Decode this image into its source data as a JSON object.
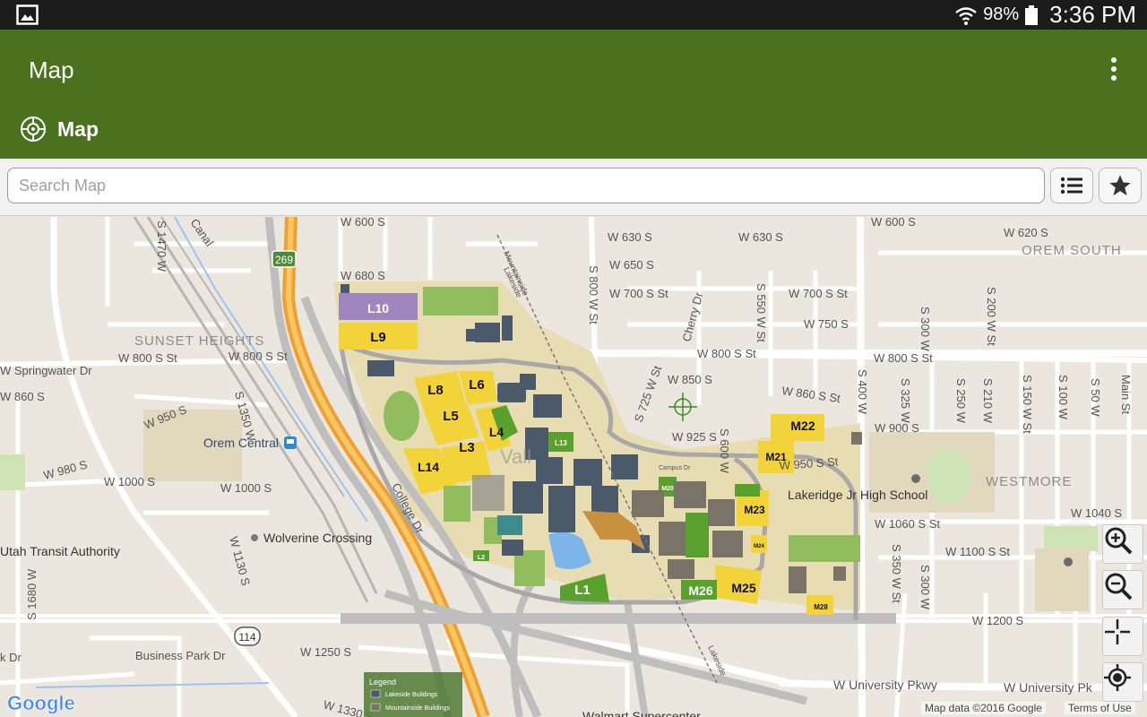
{
  "status_bar": {
    "battery": "98%",
    "time": "3:36 PM",
    "icons": [
      "gallery-icon",
      "wifi-icon",
      "battery-icon"
    ]
  },
  "app_bar": {
    "title": "Map",
    "section_label": "Map",
    "icons": [
      "overflow-menu-icon",
      "compass-icon"
    ]
  },
  "search": {
    "placeholder": "Search Map",
    "value": "",
    "list_icon": "list-icon",
    "favorites_icon": "star-icon"
  },
  "map": {
    "streets": {
      "w600s": "W 600 S",
      "w630s_a": "W 630 S",
      "w630s_b": "W 630 S",
      "w600s_r": "W 600 S",
      "w620s": "W 620 S",
      "w650s": "W 650 S",
      "w680s": "W 680 S",
      "w700st_a": "W 700 S St",
      "w700st_b": "W 700 S St",
      "w750s": "W 750 S",
      "w800st_a": "W 800 S St",
      "w800st_b": "W 800 S St",
      "w800st_c": "W 800 S St",
      "w800st_d": "W 800 S St",
      "springwater": "W Springwater Dr",
      "w860s_l": "W 860 S",
      "w850s": "W 850 S",
      "w860st": "W 860 S St",
      "w950s": "W 950 S",
      "w900s": "W 900 S",
      "w925s": "W 925 S",
      "w950st": "W 950 S St",
      "w980s": "W 980 S",
      "w1000s_a": "W 1000 S",
      "w1000s_b": "W 1000 S",
      "w1040s": "W 1040 S",
      "w1060st": "W 1060 S St",
      "w1100st": "W 1100 S St",
      "w1200s": "W 1200 S",
      "w1250s": "W 1250 S",
      "w1330s": "W 1330 S",
      "univ_a": "W University Pkwy",
      "univ_b": "W University Pk",
      "businesspark": "Business Park Dr",
      "kdr": "k Dr",
      "college_dr": "College Dr",
      "s1470w": "S 1470 W",
      "s1350w": "S 1350 W",
      "s1130s": "W 1130 S",
      "s1680w": "S 1680 W",
      "s800w": "S 800 W St",
      "s725w": "S 725 W St",
      "s600w": "S 600 W",
      "s550w": "S 550 W St",
      "s400w": "S 400 W",
      "s300w_a": "S 300 W",
      "s325w": "S 325 W",
      "s250w": "S 250 W",
      "s210w": "S 210 W",
      "s200w": "S 200 W St",
      "s150w": "S 150 W St",
      "s100w": "S 100 W",
      "s50w": "S 50 W",
      "mainst": "Main St",
      "s350w": "S 350 W St",
      "s300w_b": "S 300 W",
      "cherry": "Cherry Dr",
      "canal": "Canal",
      "mountainside": "Mountainside",
      "lakeside": "Lakeside",
      "lakeside2": "Lakeside",
      "campus_dr": "Campus Dr"
    },
    "places": {
      "orem_south": "OREM SOUTH",
      "sunset_heights": "SUNSET HEIGHTS",
      "westmore": "WESTMORE",
      "orem_central": "Orem Central",
      "lakeridge": "Lakeridge Jr High School",
      "wolverine": "Wolverine Crossing",
      "uta": "Utah Transit Authority",
      "walmart": "Walmart Supercenter",
      "campus_word": "Vall"
    },
    "routes": {
      "r269": "269",
      "r114": "114"
    },
    "lots": {
      "L10": "L10",
      "L9": "L9",
      "L8": "L8",
      "L6": "L6",
      "L5": "L5",
      "L4": "L4",
      "L3": "L3",
      "L14": "L14",
      "L13": "L13",
      "L1": "L1",
      "L2": "L2",
      "M22": "M22",
      "M21": "M21",
      "M23": "M23",
      "M20": "M20",
      "M24": "M24",
      "M25": "M25",
      "M26": "M26",
      "M28": "M28"
    },
    "legend": {
      "title": "Legend",
      "items": [
        "Lakeside Buildings",
        "Mountainside Buildings"
      ]
    },
    "attribution": {
      "google": "Google",
      "map_data": "Map data ©2016 Google",
      "terms": "Terms of Use"
    },
    "controls": [
      "zoom-in-icon",
      "zoom-out-icon",
      "crosshair-icon",
      "my-location-icon"
    ],
    "colors": {
      "app_bar": "#4a711d",
      "lot_yellow": "#f2d33a",
      "lot_purple": "#9f86bf",
      "green_area": "#5aa02c",
      "building": "#4b5a6a",
      "mountainside_building": "#7a7468"
    }
  }
}
